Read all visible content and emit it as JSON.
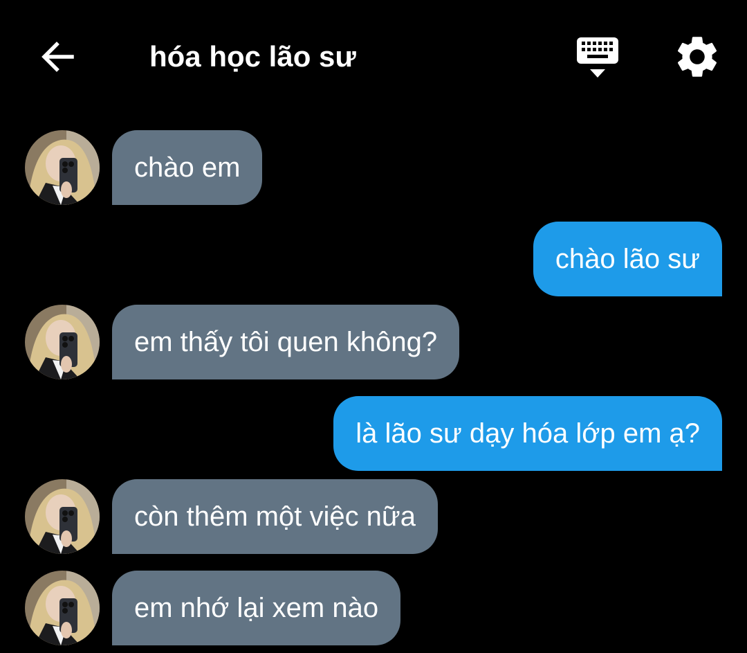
{
  "header": {
    "title": "hóa học lão sư",
    "back_icon": "arrow-left-icon",
    "keyboard_icon": "keyboard-hide-icon",
    "settings_icon": "gear-icon"
  },
  "colors": {
    "background": "#000000",
    "incoming_bubble": "#627484",
    "outgoing_bubble": "#1e9be9",
    "text": "#ffffff"
  },
  "messages": [
    {
      "direction": "in",
      "text": "chào em"
    },
    {
      "direction": "out",
      "text": "chào lão sư"
    },
    {
      "direction": "in",
      "text": "em thấy tôi quen không?"
    },
    {
      "direction": "out",
      "text": "là lão sư dạy hóa lớp em ạ?"
    },
    {
      "direction": "in",
      "text": "còn thêm một việc nữa"
    },
    {
      "direction": "in",
      "text": "em nhớ lại xem nào"
    }
  ]
}
